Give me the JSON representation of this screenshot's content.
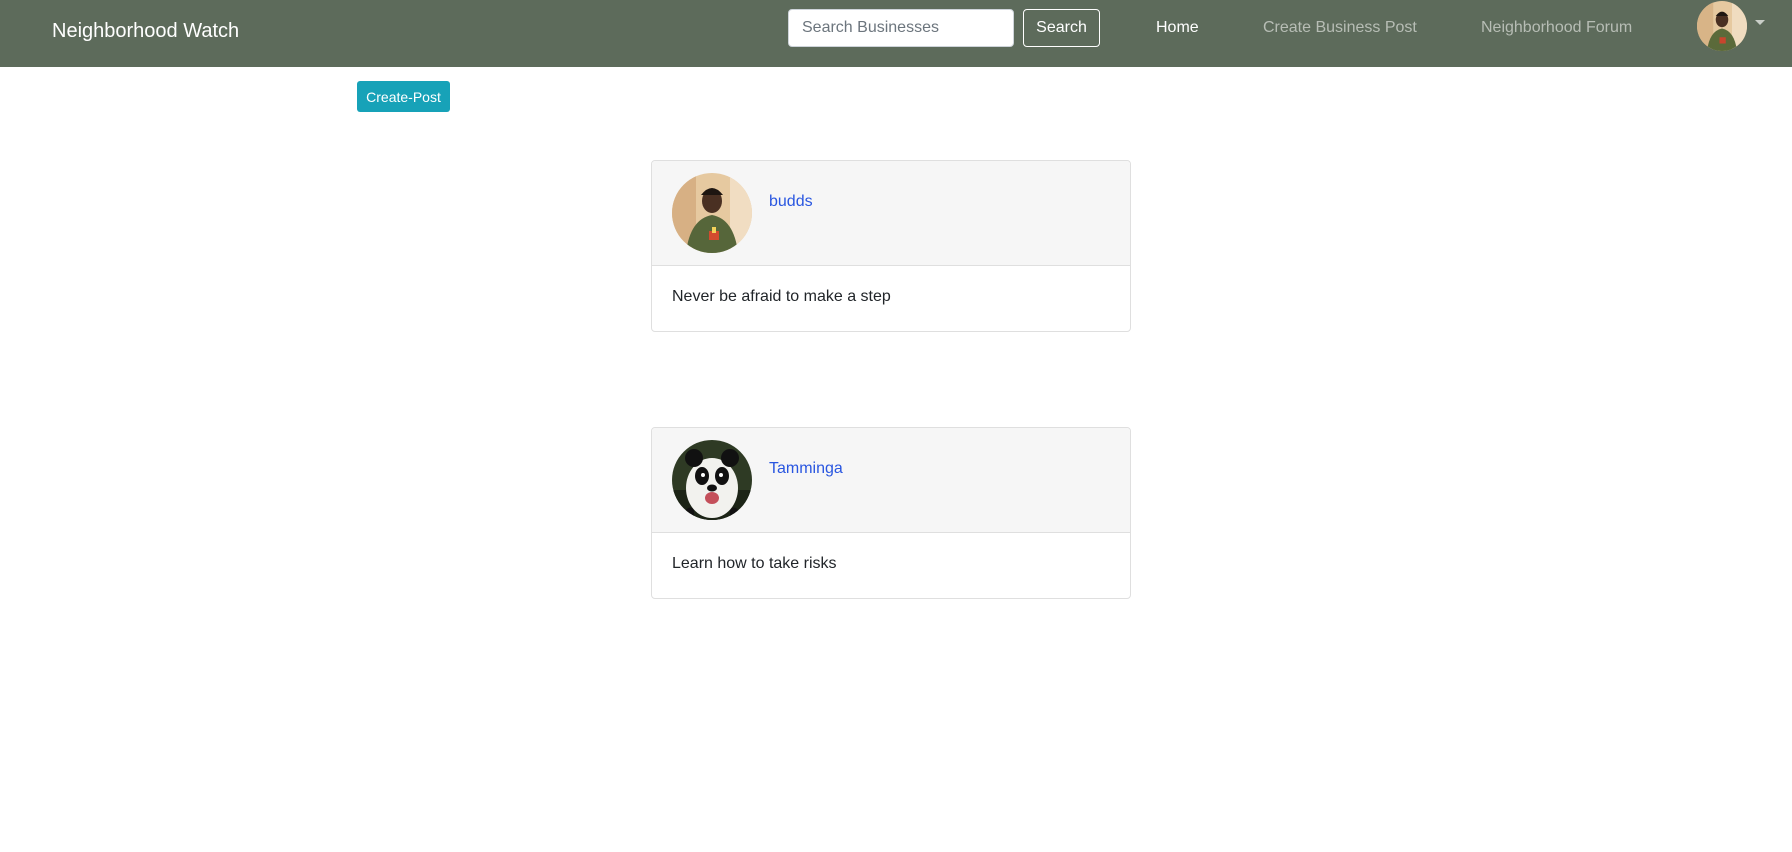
{
  "navbar": {
    "brand": "Neighborhood Watch",
    "search_placeholder": "Search Businesses",
    "search_button": "Search",
    "links": {
      "home": "Home",
      "create_business_post": "Create Business Post",
      "neighborhood_forum": "Neighborhood Forum"
    },
    "user_avatar_icon": "user-avatar-icon",
    "dropdown_icon": "caret-down-icon"
  },
  "actions": {
    "create_post": "Create-Post"
  },
  "posts": [
    {
      "username": "budds",
      "content": "Never be afraid to make a step",
      "avatar_icon": "person-avatar-icon"
    },
    {
      "username": "Tamminga",
      "content": "Learn how to take risks",
      "avatar_icon": "panda-avatar-icon"
    }
  ],
  "colors": {
    "navbar_bg": "#5d6b5b",
    "create_post_bg": "#17a2b8",
    "username_link": "#2956e0",
    "card_header_bg": "#f6f6f6"
  }
}
